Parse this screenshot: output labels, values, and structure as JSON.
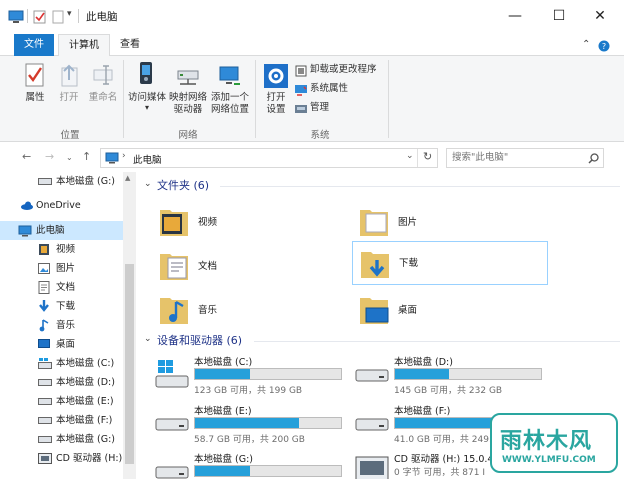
{
  "window": {
    "title": "此电脑"
  },
  "title_buttons": {
    "minimize": "—",
    "maximize": "☐",
    "close": "✕"
  },
  "ribbon_tabs": {
    "file": "文件",
    "computer": "计算机",
    "view": "查看"
  },
  "ribbon": {
    "location_group": "位置",
    "network_group": "网络",
    "system_group": "系统",
    "properties": "属性",
    "open": "打开",
    "rename": "重命名",
    "access_media": "访问媒体",
    "map_drive_l1": "映射网络",
    "map_drive_l2": "驱动器",
    "add_loc_l1": "添加一个",
    "add_loc_l2": "网络位置",
    "settings_l1": "打开",
    "settings_l2": "设置",
    "uninstall": "卸载或更改程序",
    "sys_props": "系统属性",
    "manage": "管理"
  },
  "address": {
    "path": "此电脑",
    "search_placeholder": "搜索\"此电脑\""
  },
  "sidebar": {
    "items": [
      {
        "label": "本地磁盘 (G:)",
        "icon": "drive-icon"
      },
      {
        "label": "OneDrive",
        "icon": "onedrive-icon"
      },
      {
        "label": "此电脑",
        "icon": "pc-icon"
      },
      {
        "label": "视频",
        "icon": "video-icon"
      },
      {
        "label": "图片",
        "icon": "picture-icon"
      },
      {
        "label": "文档",
        "icon": "document-icon"
      },
      {
        "label": "下载",
        "icon": "download-icon"
      },
      {
        "label": "音乐",
        "icon": "music-icon"
      },
      {
        "label": "桌面",
        "icon": "desktop-icon"
      },
      {
        "label": "本地磁盘 (C:)",
        "icon": "windows-drive-icon"
      },
      {
        "label": "本地磁盘 (D:)",
        "icon": "drive-icon"
      },
      {
        "label": "本地磁盘 (E:)",
        "icon": "drive-icon"
      },
      {
        "label": "本地磁盘 (F:)",
        "icon": "drive-icon"
      },
      {
        "label": "本地磁盘 (G:)",
        "icon": "drive-icon"
      },
      {
        "label": "CD 驱动器 (H:)",
        "icon": "cd-drive-icon"
      }
    ]
  },
  "folders": {
    "header": "文件夹 (6)",
    "items": [
      {
        "label": "视频"
      },
      {
        "label": "图片"
      },
      {
        "label": "文档"
      },
      {
        "label": "下载"
      },
      {
        "label": "音乐"
      },
      {
        "label": "桌面"
      }
    ]
  },
  "devices": {
    "header": "设备和驱动器 (6)",
    "drives": [
      {
        "name": "本地磁盘 (C:)",
        "space": "123 GB 可用，共 199 GB",
        "used_fraction": 0.38
      },
      {
        "name": "本地磁盘 (D:)",
        "space": "145 GB 可用，共 232 GB",
        "used_fraction": 0.37
      },
      {
        "name": "本地磁盘 (E:)",
        "space": "58.7 GB 可用，共 200 GB",
        "used_fraction": 0.71
      },
      {
        "name": "本地磁盘 (F:)",
        "space": "41.0 GB 可用，共 249.",
        "used_fraction": 0.84
      },
      {
        "name": "本地磁盘 (G:)",
        "space": "",
        "used_fraction": 0.38
      },
      {
        "name": "CD 驱动器 (H:) 15.0.4",
        "space": "0 字节 可用，共 871 I",
        "used_fraction": 0
      }
    ]
  },
  "watermark": {
    "logo": "雨林木风",
    "url": "WWW.YLMFU.COM"
  },
  "colors": {
    "accent": "#1979ca",
    "drive_bar": "#26a0da",
    "section_header": "#1e3287",
    "selection": "#cce8ff"
  }
}
